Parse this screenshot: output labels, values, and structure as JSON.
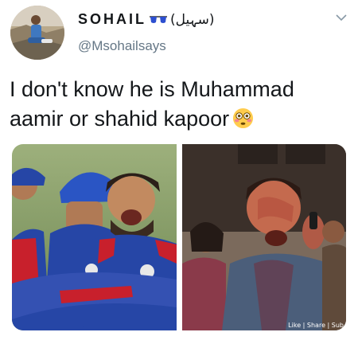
{
  "user": {
    "display_name": "SOHAIL",
    "display_name_icon": "sunglasses-icon",
    "display_name_urdu": "(سہیل)",
    "handle": "@Msohailsays"
  },
  "tweet": {
    "text_line1": "I don't know he is Muhammad",
    "text_line2": "aamir or shahid kapoor",
    "emoji": "flushed-face-emoji"
  },
  "media": {
    "watermark": "Like | Share | Sub"
  },
  "colors": {
    "text": "#14171a",
    "secondary": "#657786",
    "jersey_blue": "#2646a6",
    "jersey_red": "#c8202c"
  }
}
